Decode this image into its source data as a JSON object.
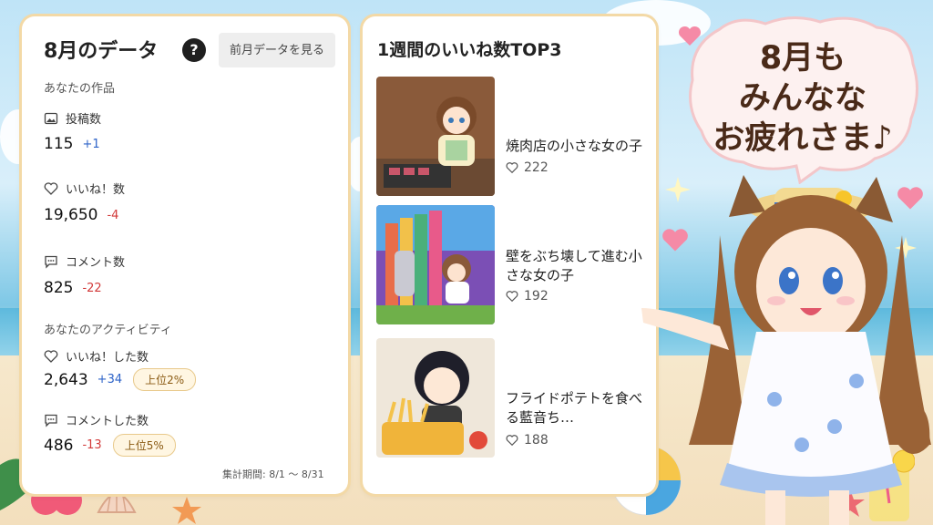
{
  "stats": {
    "title": "8月のデータ",
    "help_icon": "?",
    "prev_button": "前月データを見る",
    "your_works_label": "あなたの作品",
    "posts": {
      "label": "投稿数",
      "value": "115",
      "delta": "+1"
    },
    "likes": {
      "label": "いいね！数",
      "value": "19,650",
      "delta": "-4"
    },
    "comments": {
      "label": "コメント数",
      "value": "825",
      "delta": "-22"
    },
    "activity_label": "あなたのアクティビティ",
    "liked": {
      "label": "いいね！した数",
      "value": "2,643",
      "delta": "+34",
      "rank": "上位2%"
    },
    "commented": {
      "label": "コメントした数",
      "value": "486",
      "delta": "-13",
      "rank": "上位5%"
    },
    "period": "集計期間: 8/1 〜 8/31"
  },
  "top3": {
    "title": "1週間のいいね数TOP3",
    "items": [
      {
        "title": "焼肉店の小さな女の子",
        "likes": "222"
      },
      {
        "title": "壁をぶち壊して進む小さな女の子",
        "likes": "192"
      },
      {
        "title": "フライドポテトを食べる藍音ち…",
        "likes": "188"
      }
    ]
  },
  "banner": {
    "line1": "8月も",
    "line2": "みんなな",
    "line3": "お疲れさま♪"
  },
  "colors": {
    "positive": "#2d63c8",
    "negative": "#d23a3a",
    "card_border": "#f3d9a6",
    "bubble_text": "#4a2a18"
  }
}
